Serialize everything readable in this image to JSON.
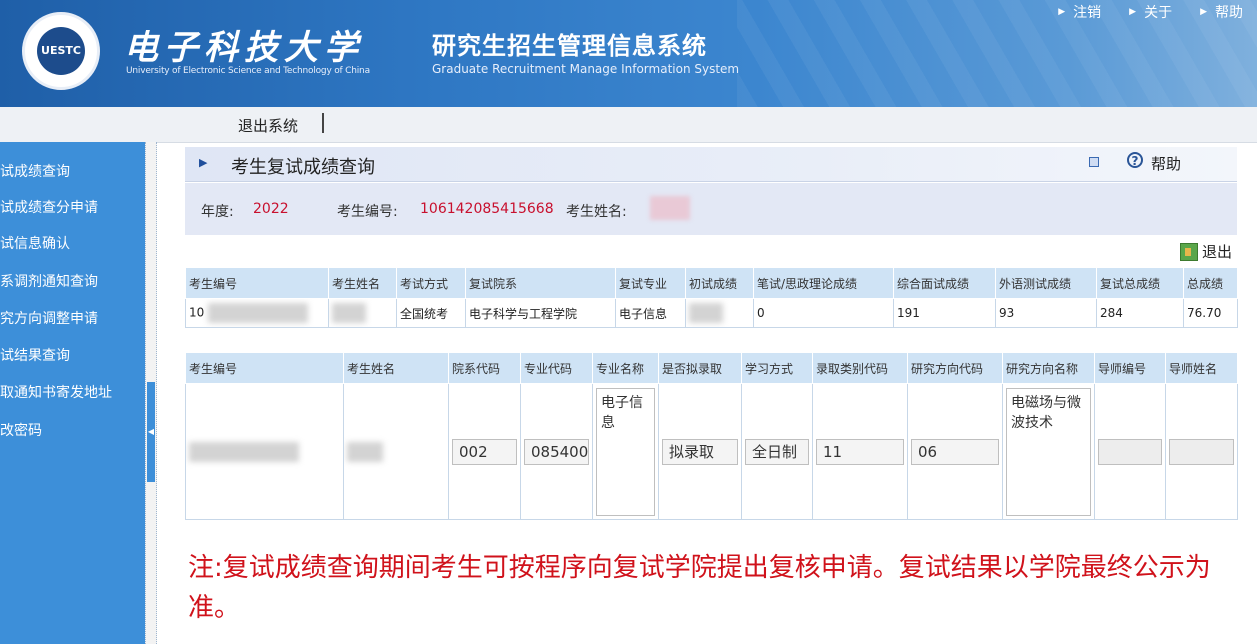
{
  "header": {
    "logo_text": "UESTC",
    "university_cn": "电子科技大学",
    "university_en": "University of Electronic Science and Technology of China",
    "system_cn": "研究生招生管理信息系统",
    "system_en": "Graduate Recruitment Manage Information System",
    "nav": [
      {
        "label": "注销"
      },
      {
        "label": "关于"
      },
      {
        "label": "帮助"
      }
    ]
  },
  "toolbar": {
    "exit_label": "退出系统"
  },
  "sidebar": {
    "items": [
      {
        "label": "试成绩查询"
      },
      {
        "label": "试成绩查分申请"
      },
      {
        "label": "试信息确认"
      },
      {
        "label": "系调剂通知查询"
      },
      {
        "label": "究方向调整申请"
      },
      {
        "label": "试结果查询"
      },
      {
        "label": "取通知书寄发地址"
      },
      {
        "label": "改密码"
      }
    ]
  },
  "panel": {
    "title": "考生复试成绩查询",
    "help_label": "帮助"
  },
  "info": {
    "year_label": "年度:",
    "year_value": "2022",
    "exam_no_label": "考生编号:",
    "exam_no_value": "106142085415668",
    "name_label": "考生姓名:"
  },
  "exit_button_label": "退出",
  "score_table": {
    "headers": [
      "考生编号",
      "考生姓名",
      "考试方式",
      "复试院系",
      "复试专业",
      "初试成绩",
      "笔试/思政理论成绩",
      "综合面试成绩",
      "外语测试成绩",
      "复试总成绩",
      "总成绩"
    ],
    "row": {
      "exam_no_prefix": "10",
      "exam_mode": "全国统考",
      "department": "电子科学与工程学院",
      "major": "电子信息",
      "written_score": "0",
      "interview_score": "191",
      "foreign_lang_score": "93",
      "retest_total": "284",
      "total_score": "76.70"
    }
  },
  "admit_table": {
    "headers": [
      "考生编号",
      "考生姓名",
      "院系代码",
      "专业代码",
      "专业名称",
      "是否拟录取",
      "学习方式",
      "录取类别代码",
      "研究方向代码",
      "研究方向名称",
      "导师编号",
      "导师姓名"
    ],
    "row": {
      "dept_code": "002",
      "major_code": "085400",
      "major_name": "电子信息",
      "admit_status": "拟录取",
      "study_mode": "全日制",
      "category_code": "11",
      "direction_code": "06",
      "direction_name": "电磁场与微波技术",
      "advisor_no": "",
      "advisor_name": ""
    }
  },
  "note": "注:复试成绩查询期间考生可按程序向复试学院提出复核申请。复试结果以学院最终公示为准。",
  "colors": {
    "header_blue": "#2f78c4",
    "sidebar_blue": "#3d8fd9",
    "accent_red": "#c8102e",
    "table_header": "#cfe3f5"
  }
}
